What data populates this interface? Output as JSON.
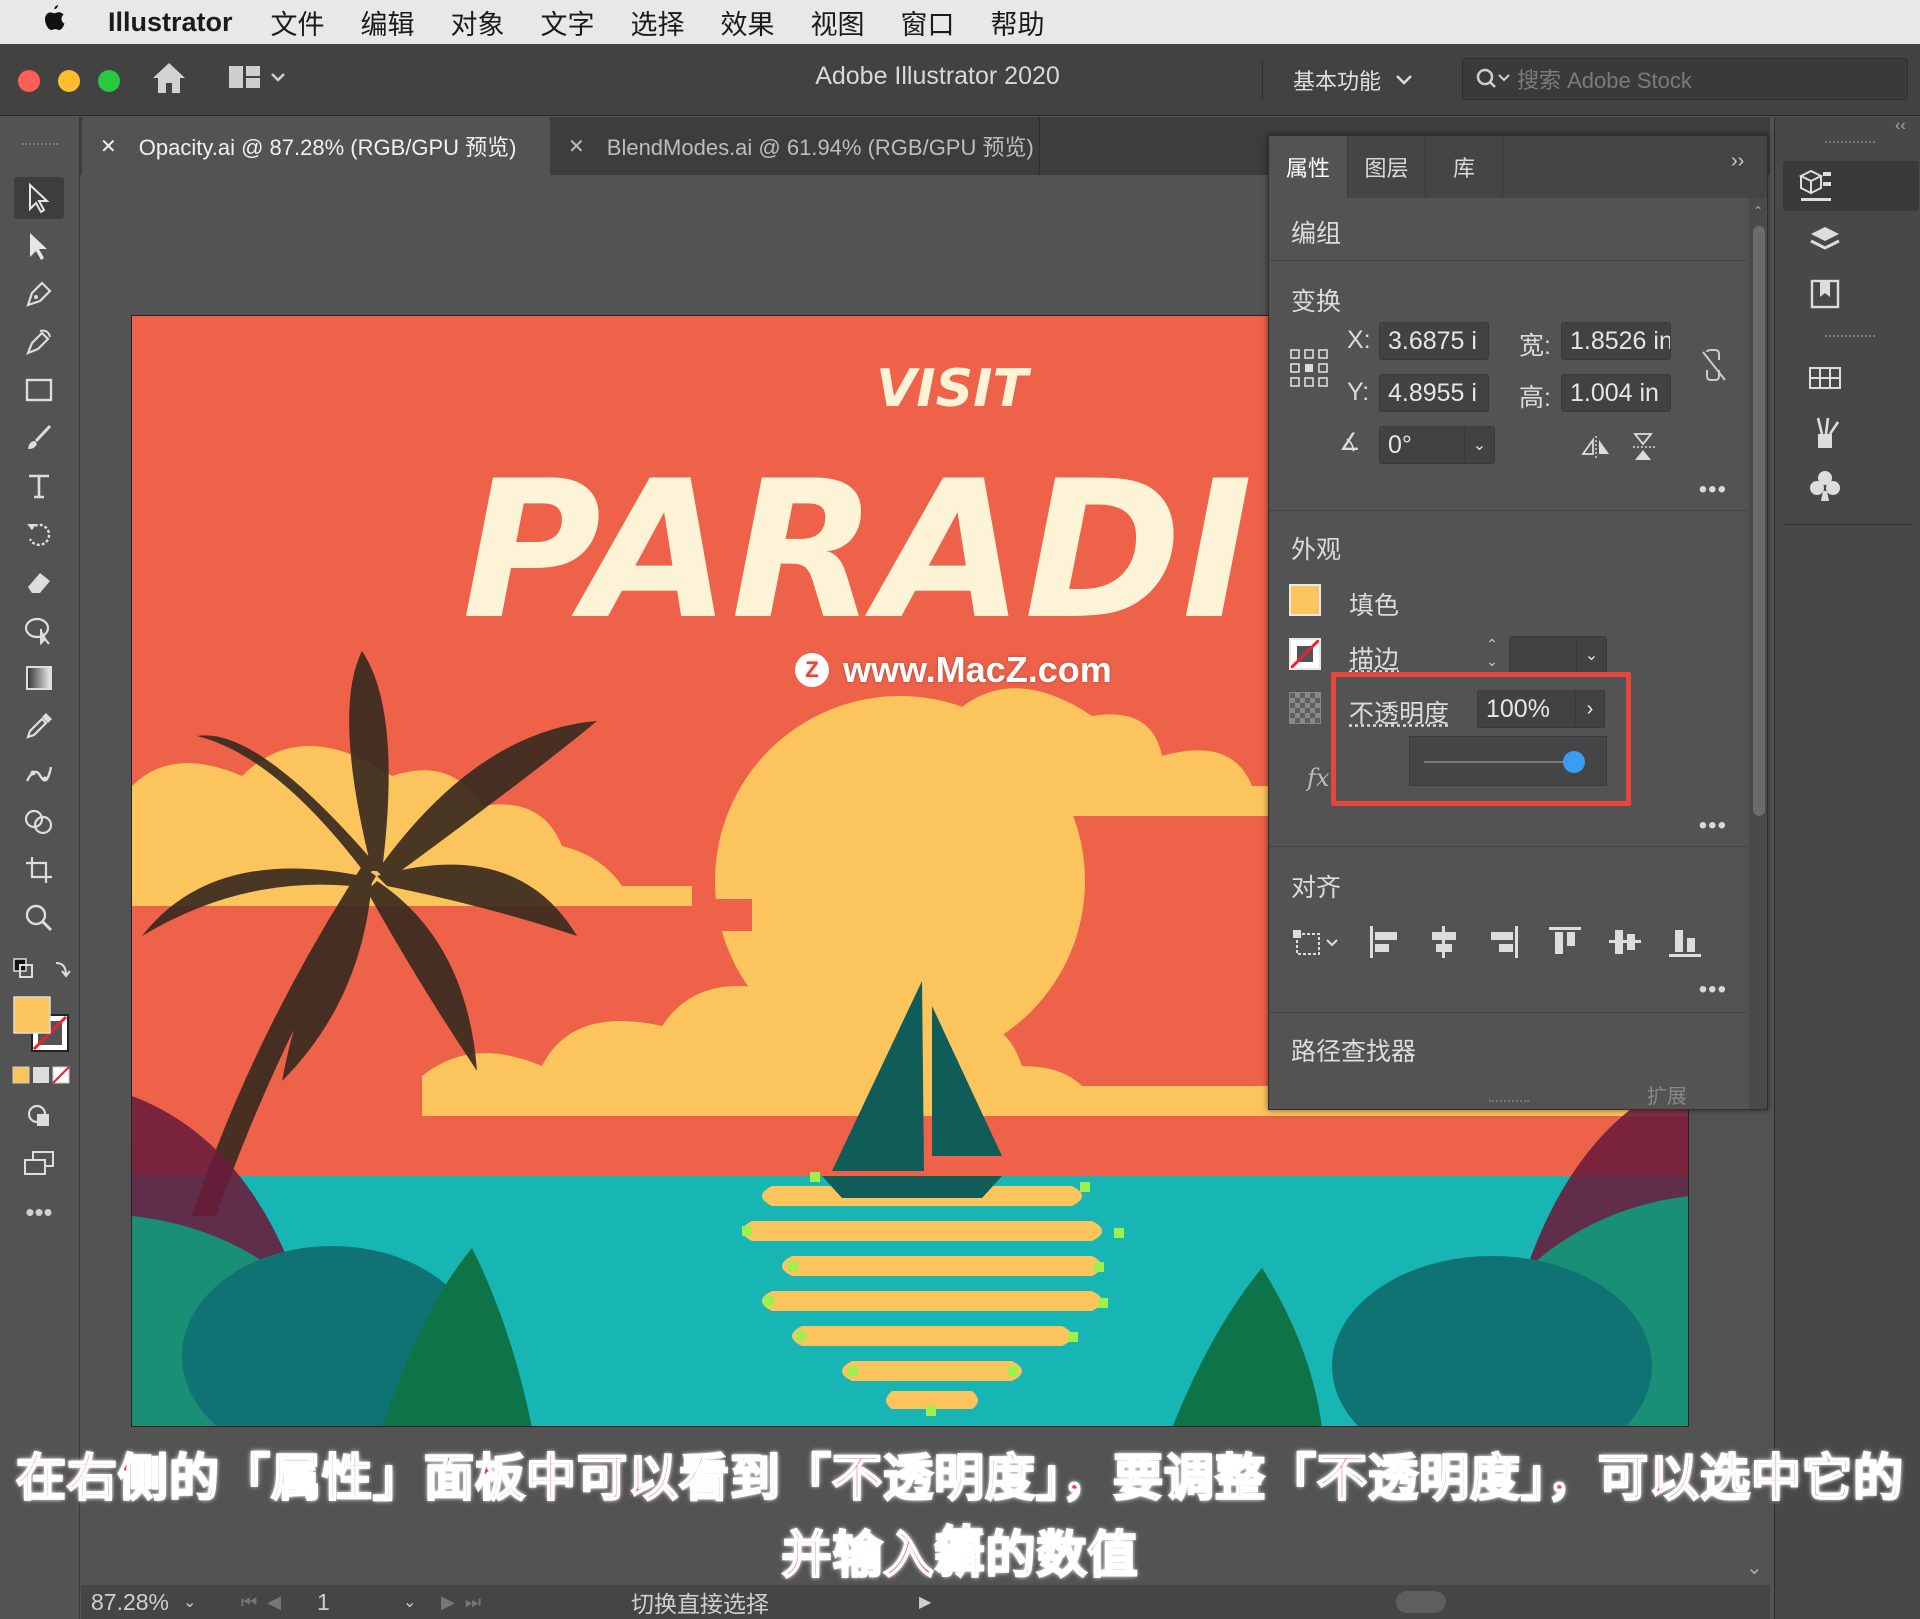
{
  "menubar": {
    "app": "Illustrator",
    "items": [
      "文件",
      "编辑",
      "对象",
      "文字",
      "选择",
      "效果",
      "视图",
      "窗口",
      "帮助"
    ]
  },
  "titlebar": {
    "title": "Adobe Illustrator 2020",
    "workspace": "基本功能",
    "stock_placeholder": "搜索 Adobe Stock"
  },
  "tabs": [
    {
      "label": "Opacity.ai @ 87.28% (RGB/GPU 预览)",
      "active": true
    },
    {
      "label": "BlendModes.ai @ 61.94% (RGB/GPU 预览)",
      "active": false
    }
  ],
  "artwork": {
    "visit": "VISIT",
    "headline": "PARADI",
    "watermark": "www.MacZ.com",
    "watermark_badge": "Z"
  },
  "panel": {
    "tabs": [
      "属性",
      "图层",
      "库"
    ],
    "object_type": "编组",
    "transform": {
      "title": "变换",
      "x_label": "X:",
      "x": "3.6875 i",
      "y_label": "Y:",
      "y": "4.8955 i",
      "w_label": "宽:",
      "w": "1.8526 in",
      "h_label": "高:",
      "h": "1.004 in",
      "angle": "0°"
    },
    "appearance": {
      "title": "外观",
      "fill": "填色",
      "stroke": "描边",
      "opacity_label": "不透明度",
      "opacity_value": "100%",
      "opacity_slider": 1.0,
      "fx": "fx."
    },
    "align": {
      "title": "对齐"
    },
    "pathfinder": {
      "title": "路径查找器",
      "expand": "扩展"
    }
  },
  "statusbar": {
    "zoom": "87.28%",
    "page": "1",
    "tool_hint": "切换直接选择"
  },
  "subtitle": {
    "line1": "在右侧的「属性」面板中可以看到「不透明度」，要调整「不透明度」，可以选中它的值",
    "line2": "并输入新的数值"
  },
  "colors": {
    "sky": "#ed6249",
    "sun": "#fcc45c",
    "sea": "#17b6b5",
    "highlight_box": "#e8453a",
    "slider_knob": "#3b9cf3"
  }
}
